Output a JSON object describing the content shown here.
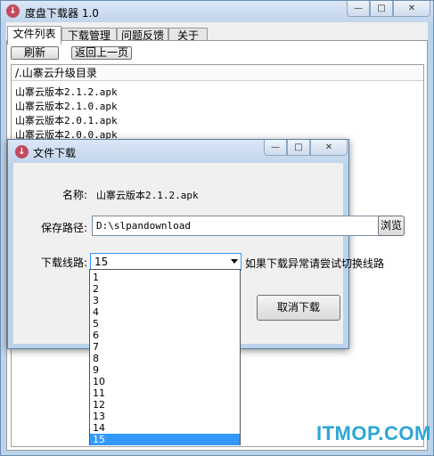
{
  "main_window": {
    "title": "度盘下载器 1.0",
    "controls": {
      "minimize": "—",
      "maximize": "□",
      "close": "✕"
    },
    "tabs": [
      "文件列表",
      "下载管理",
      "问题反馈",
      "关于"
    ],
    "active_tab": 0,
    "toolbar": {
      "refresh": "刷新",
      "back": "返回上一页"
    },
    "list_header": "/.山寨云升级目录",
    "files": [
      "山寨云版本2.1.2.apk",
      "山寨云版本2.1.0.apk",
      "山寨云版本2.0.1.apk",
      "山寨云版本2.0.0.apk"
    ]
  },
  "dialog": {
    "title": "文件下载",
    "controls": {
      "minimize": "—",
      "maximize": "□",
      "close": "✕"
    },
    "name_label": "名称:",
    "name_value": "山寨云版本2.1.2.apk",
    "path_label": "保存路径:",
    "path_value": "D:\\slpandownload",
    "browse_button": "浏览",
    "line_label": "下载线路:",
    "line_value": "15",
    "hint": "如果下载异常请尝试切换线路",
    "cancel_button": "取消下载"
  },
  "dropdown": {
    "options": [
      "1",
      "2",
      "3",
      "4",
      "5",
      "6",
      "7",
      "8",
      "9",
      "10",
      "11",
      "12",
      "13",
      "14",
      "15"
    ],
    "selected": "15"
  },
  "colors": {
    "selection": "#3399ff",
    "title_bar": "#c2d5ec",
    "icon": "#c44a5e",
    "watermark": "#2aa6d8"
  },
  "watermark": "ITMOP.COM"
}
